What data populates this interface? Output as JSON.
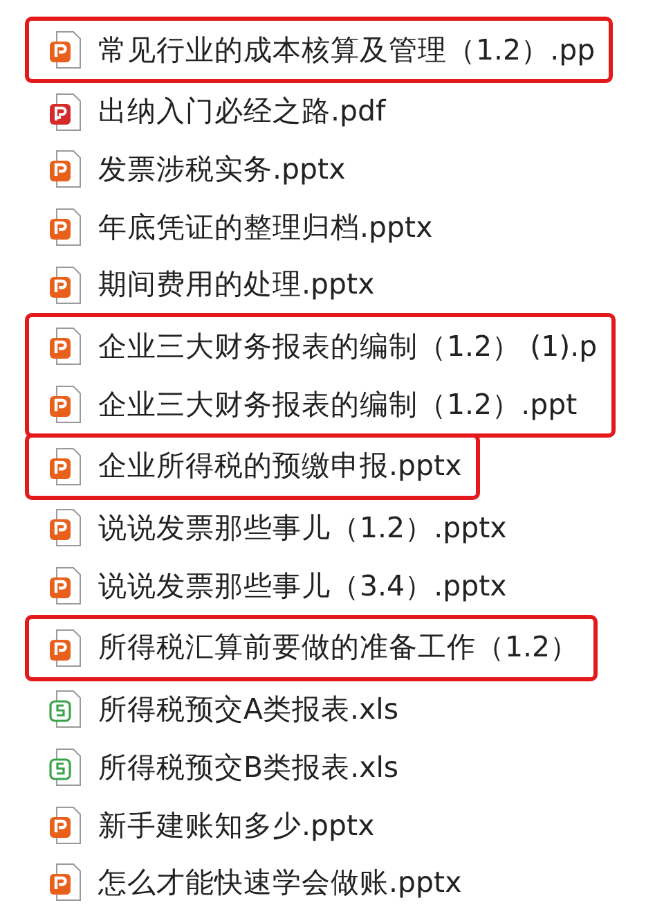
{
  "groups": [
    {
      "highlighted": true,
      "files": [
        {
          "kind": "pptx",
          "name": "常见行业的成本核算及管理（1.2）.pp"
        }
      ]
    },
    {
      "highlighted": false,
      "files": [
        {
          "kind": "pdf",
          "name": "出纳入门必经之路.pdf"
        },
        {
          "kind": "pptx",
          "name": "发票涉税实务.pptx"
        },
        {
          "kind": "pptx",
          "name": "年底凭证的整理归档.pptx"
        },
        {
          "kind": "pptx",
          "name": "期间费用的处理.pptx"
        }
      ]
    },
    {
      "highlighted": true,
      "files": [
        {
          "kind": "pptx",
          "name": "企业三大财务报表的编制（1.2） (1).p"
        },
        {
          "kind": "pptx",
          "name": "企业三大财务报表的编制（1.2）.ppt"
        }
      ]
    },
    {
      "highlighted": true,
      "files": [
        {
          "kind": "pptx",
          "name": "企业所得税的预缴申报.pptx"
        }
      ]
    },
    {
      "highlighted": false,
      "files": [
        {
          "kind": "pptx",
          "name": "说说发票那些事儿（1.2）.pptx"
        },
        {
          "kind": "pptx",
          "name": "说说发票那些事儿（3.4）.pptx"
        }
      ]
    },
    {
      "highlighted": true,
      "files": [
        {
          "kind": "pptx",
          "name": "所得税汇算前要做的准备工作（1.2）"
        }
      ]
    },
    {
      "highlighted": false,
      "files": [
        {
          "kind": "xls",
          "name": "所得税预交A类报表.xls"
        },
        {
          "kind": "xls",
          "name": "所得税预交B类报表.xls"
        },
        {
          "kind": "pptx",
          "name": "新手建账知多少.pptx"
        },
        {
          "kind": "pptx",
          "name": "怎么才能快速学会做账.pptx"
        }
      ]
    }
  ]
}
